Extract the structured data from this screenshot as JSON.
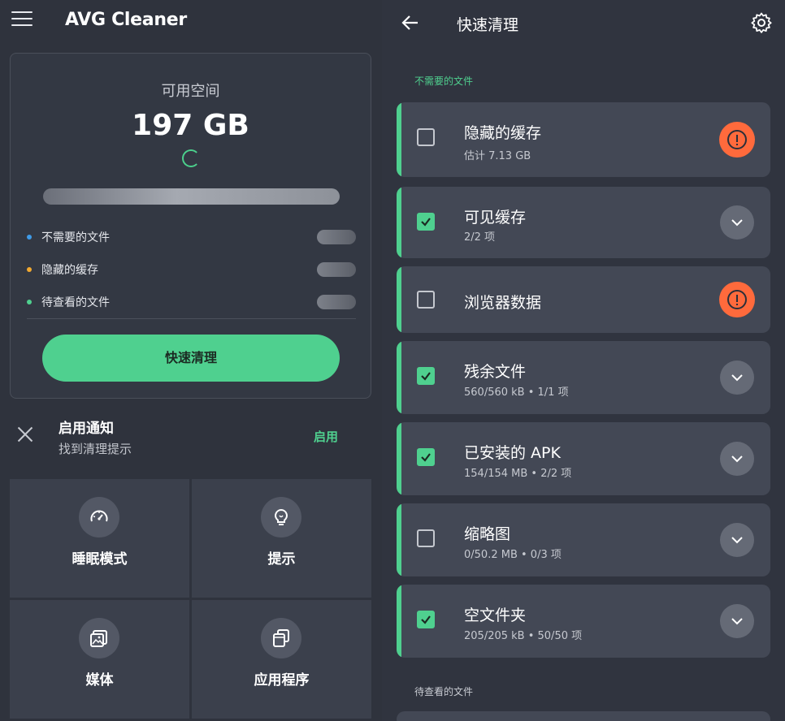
{
  "left": {
    "app_title": "AVG Cleaner",
    "space": {
      "label": "可用空间",
      "value": "197 GB"
    },
    "legend": [
      {
        "label": "不需要的文件",
        "color": "#3f9be8"
      },
      {
        "label": "隐藏的缓存",
        "color": "#f2a930"
      },
      {
        "label": "待查看的文件",
        "color": "#4fd08f"
      }
    ],
    "quick_clean_label": "快速清理",
    "notification": {
      "title": "启用通知",
      "subtitle": "找到清理提示",
      "action": "启用"
    },
    "tiles": [
      {
        "label": "睡眠模式",
        "icon": "speedometer-icon"
      },
      {
        "label": "提示",
        "icon": "lightbulb-icon"
      },
      {
        "label": "媒体",
        "icon": "image-icon"
      },
      {
        "label": "应用程序",
        "icon": "apps-icon"
      }
    ]
  },
  "right": {
    "title": "快速清理",
    "section_unneeded": "不需要的文件",
    "section_review": "待查看的文件",
    "items": [
      {
        "title": "隐藏的缓存",
        "subtitle": "估计 7.13 GB",
        "checked": false,
        "action": "warning"
      },
      {
        "title": "可见缓存",
        "subtitle": "2/2 项",
        "checked": true,
        "action": "expand"
      },
      {
        "title": "浏览器数据",
        "subtitle": "",
        "checked": false,
        "action": "warning"
      },
      {
        "title": "残余文件",
        "subtitle": "560/560 kB • 1/1 项",
        "checked": true,
        "action": "expand"
      },
      {
        "title": "已安装的 APK",
        "subtitle": "154/154 MB • 2/2 项",
        "checked": true,
        "action": "expand"
      },
      {
        "title": "缩略图",
        "subtitle": "0/50.2 MB • 0/3 项",
        "checked": false,
        "action": "expand"
      },
      {
        "title": "空文件夹",
        "subtitle": "205/205 kB • 50/50 项",
        "checked": true,
        "action": "expand"
      }
    ]
  },
  "colors": {
    "accent": "#4fd08f",
    "warning": "#ff6a3c",
    "background": "#30343f"
  }
}
